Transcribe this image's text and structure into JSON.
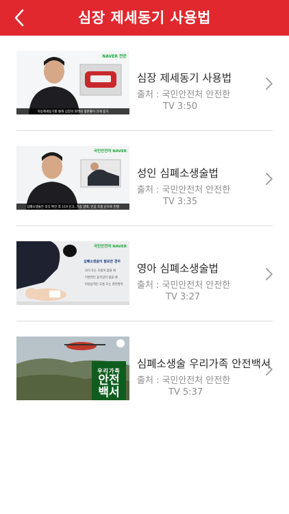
{
  "header": {
    "title": "심장 제세동기 사용법",
    "back_icon": "chevron-left-icon"
  },
  "videos": [
    {
      "title": "심장 제세동기 사용법",
      "source_label": "출처 :",
      "source": "국민안전처 안전한",
      "duration": "TV 3:50",
      "thumb_logo": "NAVER 전문",
      "thumb_caption": "자동제세동기를 통해 심장의 원래의 생존률이 크게 증가"
    },
    {
      "title": "성인 심폐소생술법",
      "source_label": "출처  :",
      "source": "국민안전처 안전한",
      "duration": "TV 3:35",
      "thumb_logo": "국민안전처 NAVER",
      "thumb_caption": "심폐소생술은 의식 확인 후 119 신고, 가슴 압박, 인공 호흡 순으로 진행"
    },
    {
      "title": "영아 심폐소생술법",
      "source_label": "출처  :",
      "source": "국민안전처 안전한",
      "duration": "TV 3:27",
      "thumb_logo": "국민안전처 NAVER",
      "thumb_heading": "심폐소생술이 필요한 경우",
      "thumb_points": [
        "의식 또는 호흡이 없을 때",
        "지발적인 움직임이 없을 때",
        "비정상적인 호흡 또는 경련발작"
      ]
    },
    {
      "title": "심폐소생술 우리가족 안전백서",
      "source_label": "출처  :",
      "source": "국민안전처 안전한",
      "duration": "TV 5:37",
      "thumb_overlay_small": "우리가족",
      "thumb_overlay_big": "안전백서"
    }
  ],
  "colors": {
    "accent": "#e0282e",
    "text": "#2a2a2a",
    "muted": "#8e8e8e"
  }
}
